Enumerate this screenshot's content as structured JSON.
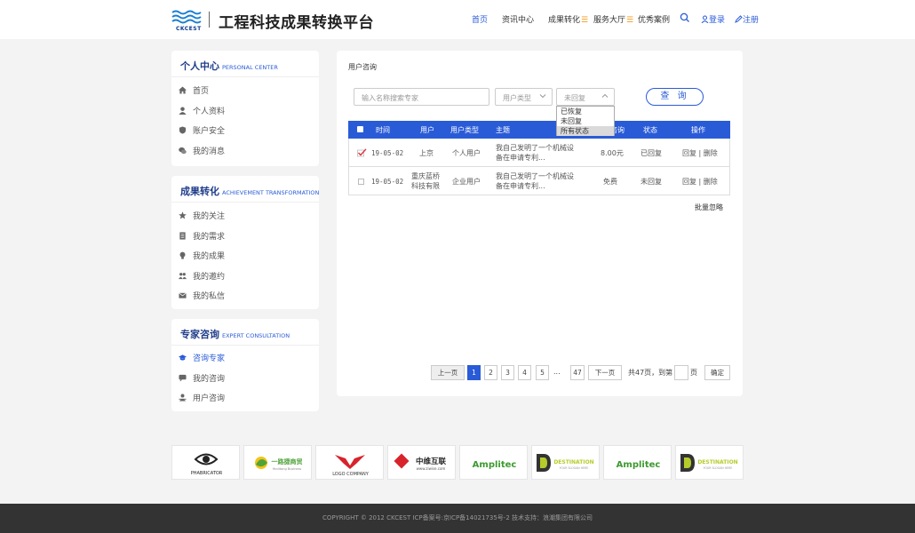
{
  "header": {
    "logo_text": "CKCEST",
    "site_title": "工程科技成果转换平台",
    "nav": [
      {
        "label": "首页",
        "active": true,
        "menu": false
      },
      {
        "label": "资讯中心",
        "active": false,
        "menu": false
      },
      {
        "label": "成果转化",
        "active": false,
        "menu": true
      },
      {
        "label": "服务大厅",
        "active": false,
        "menu": true
      },
      {
        "label": "优秀案例",
        "active": false,
        "menu": false
      }
    ],
    "menu_mark": "☰",
    "login": "登录",
    "register": "注册"
  },
  "sidebar": {
    "personal": {
      "title": "个人中心",
      "subtitle": "PERSONAL CENTER",
      "items": [
        {
          "label": "首页",
          "icon": "home-icon"
        },
        {
          "label": "个人资料",
          "icon": "user-icon"
        },
        {
          "label": "账户安全",
          "icon": "shield-icon"
        },
        {
          "label": "我的消息",
          "icon": "chat-icon"
        }
      ]
    },
    "achievement": {
      "title": "成果转化",
      "subtitle": "ACHIEVEMENT TRANSFORMATION",
      "items": [
        {
          "label": "我的关注",
          "icon": "star-icon"
        },
        {
          "label": "我的需求",
          "icon": "document-icon"
        },
        {
          "label": "我的成果",
          "icon": "bulb-icon"
        },
        {
          "label": "我的邀约",
          "icon": "group-icon"
        },
        {
          "label": "我的私信",
          "icon": "mail-icon"
        }
      ]
    },
    "expert": {
      "title": "专家咨询",
      "subtitle": "EXPERT CONSULTATION",
      "items": [
        {
          "label": "咨询专家",
          "icon": "graduation-cap-icon",
          "active": true
        },
        {
          "label": "我的咨询",
          "icon": "chat-icon",
          "active": false
        },
        {
          "label": "用户咨询",
          "icon": "user-card-icon",
          "active": false
        }
      ]
    }
  },
  "main": {
    "breadcrumb": "用户咨询",
    "search_placeholder": "输入名称搜索专家",
    "user_type_placeholder": "用户类型",
    "status_value": "未回复",
    "query_button": "查 询",
    "status_options": [
      "已恢复",
      "未回复",
      "所有状态"
    ],
    "status_highlight": 2,
    "columns": [
      "时间",
      "用户",
      "用户类型",
      "主题",
      "咨询",
      "状态",
      "操作"
    ],
    "rows": [
      {
        "checked": true,
        "time": "19-05-02",
        "user": "上京",
        "user_type": "个人用户",
        "topic": "我自己发明了一个机械设备在申请专利...",
        "fee": "8.00元",
        "status": "已回复",
        "actions": "回复 | 删除"
      },
      {
        "checked": false,
        "time": "19-05-02",
        "user": "重庆蓝桥科技有限",
        "user_type": "企业用户",
        "topic": "我自己发明了一个机械设备在申请专利...",
        "fee": "免费",
        "status": "未回复",
        "actions": "回复 | 删除"
      }
    ],
    "batch_ignore": "批量忽略",
    "pager": {
      "prev": "上一页",
      "pages": [
        "1",
        "2",
        "3",
        "4",
        "5"
      ],
      "ellipsis": "...",
      "last": "47",
      "next": "下一页",
      "total": "共47页，到第",
      "page_unit": "页",
      "confirm": "确定"
    }
  },
  "partners": [
    "PHABRICATOR",
    "一路捷商贸",
    "LOGO COMPANY",
    "中维互联",
    "Amplitec",
    "DESTINATION",
    "Amplitec",
    "DESTINATION"
  ],
  "partner_sub": {
    "zhongwei": "www.ziwise.com",
    "yilujie": "Yanlitong Business",
    "destination": "YOUR SLOGAN HERE"
  },
  "footer": "COPYRIGHT © 2012 CKCEST ICP备案号:京ICP备14021735号-2  技术支持：浪潮集团有限公司"
}
